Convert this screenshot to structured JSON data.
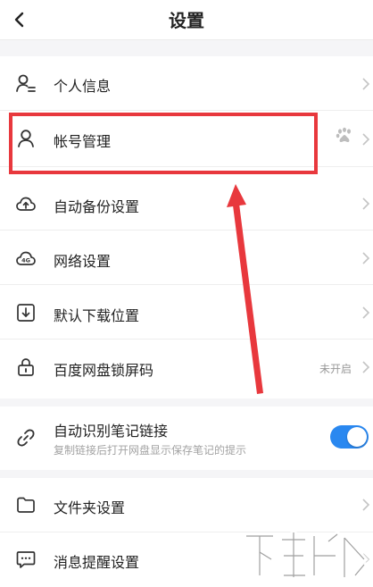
{
  "header": {
    "title": "设置",
    "back_icon": "chevron-left-icon"
  },
  "settings": {
    "personal_info": {
      "label": "个人信息",
      "icon": "person-list-icon"
    },
    "account": {
      "label": "帐号管理",
      "icon": "person-icon",
      "badge_icon": "baidu-paw-icon"
    },
    "auto_backup": {
      "label": "自动备份设置",
      "icon": "cloud-upload-icon"
    },
    "network": {
      "label": "网络设置",
      "icon": "cloud-4g-icon",
      "icon_text": "4G"
    },
    "download_location": {
      "label": "默认下载位置",
      "icon": "download-icon"
    },
    "screen_lock": {
      "label": "百度网盘锁屏码",
      "icon": "lock-icon",
      "status": "未开启"
    },
    "note_link": {
      "label": "自动识别笔记链接",
      "description": "复制链接后打开网盘显示保存笔记的提示",
      "icon": "link-icon",
      "toggle_on": true
    },
    "folder": {
      "label": "文件夹设置",
      "icon": "folder-icon"
    },
    "notifications": {
      "label": "消息提醒设置",
      "icon": "chat-bubble-icon"
    }
  },
  "colors": {
    "highlight": "#e8383d",
    "toggle_on": "#2a88f0",
    "background": "#f5f5f7"
  }
}
